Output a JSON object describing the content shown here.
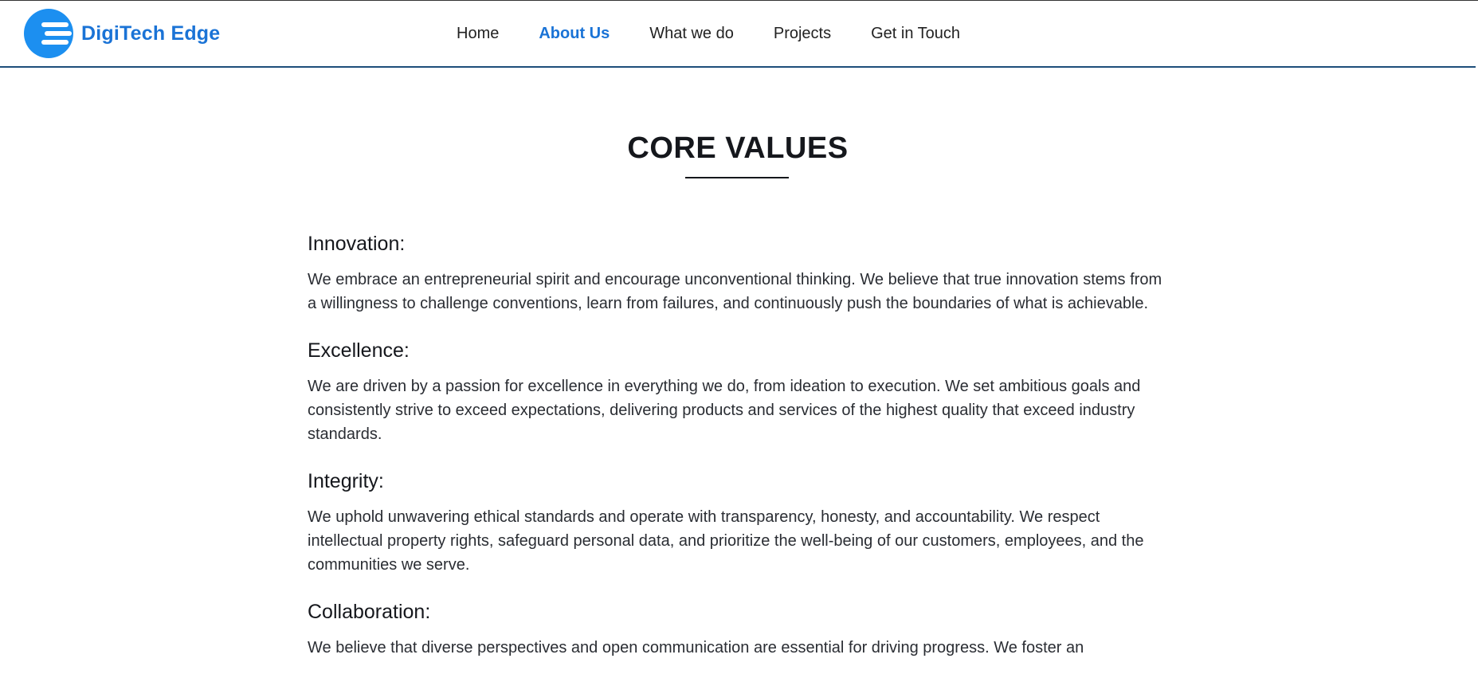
{
  "header": {
    "brand": "DigiTech Edge",
    "logo_icon": "digitech-edge-logo-icon",
    "nav": [
      {
        "label": "Home",
        "active": false
      },
      {
        "label": "About Us",
        "active": true
      },
      {
        "label": "What we do",
        "active": false
      },
      {
        "label": "Projects",
        "active": false
      },
      {
        "label": "Get in Touch",
        "active": false
      }
    ]
  },
  "main": {
    "title": "CORE VALUES",
    "values": [
      {
        "heading": "Innovation:",
        "text": "We embrace an entrepreneurial spirit and encourage unconventional thinking. We believe that true innovation stems from a willingness to challenge conventions, learn from failures, and continuously push the boundaries of what is achievable."
      },
      {
        "heading": "Excellence:",
        "text": "We are driven by a passion for excellence in everything we do, from ideation to execution. We set ambitious goals and consistently strive to exceed expectations, delivering products and services of the highest quality that exceed industry standards."
      },
      {
        "heading": "Integrity:",
        "text": "We uphold unwavering ethical standards and operate with transparency, honesty, and accountability. We respect intellectual property rights, safeguard personal data, and prioritize the well-being of our customers, employees, and the communities we serve."
      },
      {
        "heading": "Collaboration:",
        "text": "We believe that diverse perspectives and open communication are essential for driving progress. We foster an"
      }
    ]
  },
  "colors": {
    "brand": "#1a73d6",
    "logo_circle": "#1c8ff0",
    "header_border": "#1d4e7a",
    "text": "#15171c"
  }
}
